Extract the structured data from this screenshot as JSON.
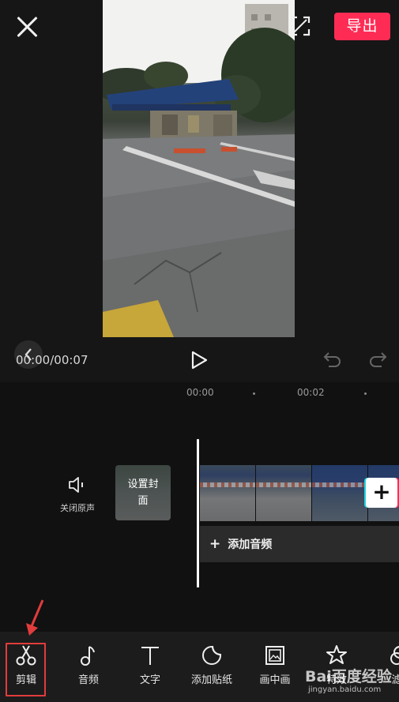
{
  "header": {
    "export_label": "导出"
  },
  "player": {
    "time_readout": "00:00/00:07"
  },
  "timeline": {
    "ruler": [
      "00:00",
      "00:02"
    ],
    "mute_label": "关闭原声",
    "cover_label": "设置封面",
    "add_clip_symbol": "+",
    "add_audio_plus": "+",
    "add_audio_label": "添加音频"
  },
  "toolbar": {
    "items": [
      {
        "label": "剪辑",
        "icon": "scissors-icon"
      },
      {
        "label": "音频",
        "icon": "music-note-icon"
      },
      {
        "label": "文字",
        "icon": "text-icon"
      },
      {
        "label": "添加贴纸",
        "icon": "sticker-icon"
      },
      {
        "label": "画中画",
        "icon": "picture-in-picture-icon"
      },
      {
        "label": "特效",
        "icon": "effects-star-icon"
      },
      {
        "label": "滤",
        "icon": "filter-icon"
      }
    ],
    "selected": "剪辑",
    "highlight_color": "#e23c3c"
  },
  "watermark": {
    "logo": "Bai百度经验",
    "url": "jingyan.baidu.com"
  },
  "colors": {
    "accent": "#fe2c55",
    "background": "#101010"
  }
}
